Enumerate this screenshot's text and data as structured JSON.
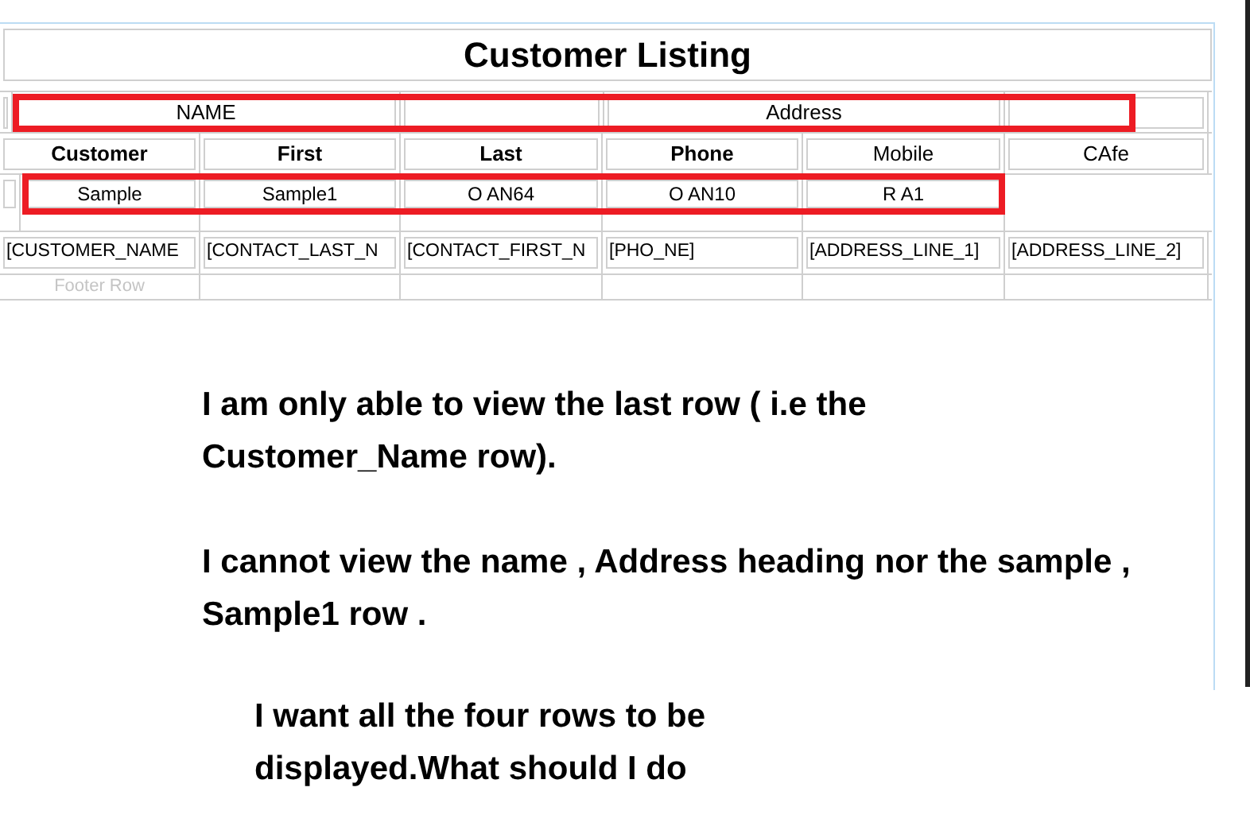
{
  "report": {
    "title": "Customer Listing",
    "group_header_row": [
      "NAME",
      "Address"
    ],
    "column_header_row": [
      "Customer",
      "First",
      "Last",
      "Phone",
      "Mobile",
      "CAfe"
    ],
    "sample_row": [
      "Sample",
      "Sample1",
      "O AN64",
      "O AN10",
      "R A1"
    ],
    "field_row": [
      "[CUSTOMER_NAME",
      "[CONTACT_LAST_N",
      "[CONTACT_FIRST_N",
      "[PHO_NE]",
      "[ADDRESS_LINE_1]",
      "[ADDRESS_LINE_2]"
    ],
    "footer_row": [
      "Footer Row"
    ]
  },
  "question": {
    "paragraphs": [
      "I am only able to view the last row ( i.e the Customer_Name row).",
      "I cannot view the name , Address heading nor the sample , Sample1 row .",
      "I want all the four rows to be displayed.What should I do"
    ]
  }
}
